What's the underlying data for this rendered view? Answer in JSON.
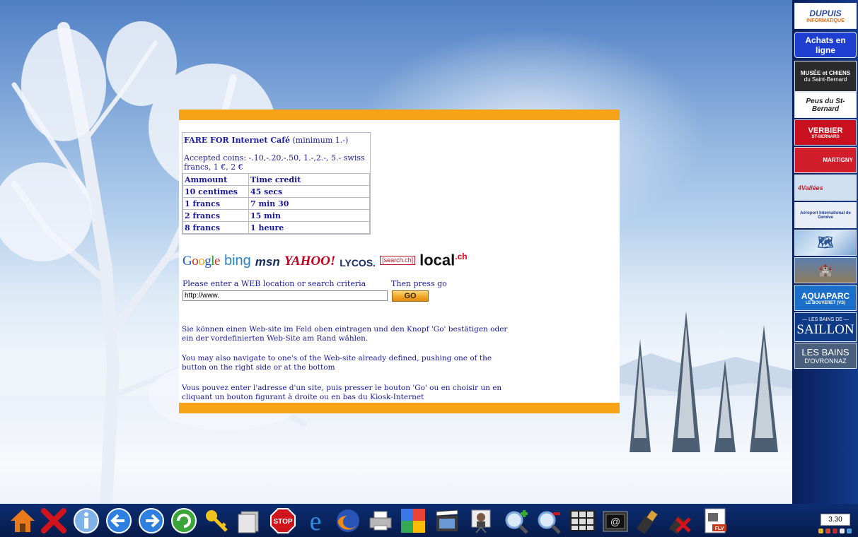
{
  "fare": {
    "title_bold": "FARE FOR  Internet Café",
    "title_rest": " (minimum 1.-)",
    "coins": "Accepted coins:  -.10,-.20,-.50,   1.-,2.-, 5.- swiss francs, 1 €, 2 €",
    "headers": [
      "Ammount",
      "Time credit"
    ],
    "rows": [
      [
        "10 centimes",
        "45 secs"
      ],
      [
        "1 francs",
        "7 min 30"
      ],
      [
        "2 francs",
        "15 min"
      ],
      [
        "8 francs",
        "1 heure"
      ]
    ]
  },
  "engines": {
    "google": "Google",
    "bing": "bing",
    "msn": "msn",
    "yahoo": "YAHOO!",
    "lycos": "LYCOS.",
    "searchch": "[search.ch]",
    "local": "local",
    "local_suffix": ".ch"
  },
  "search": {
    "prompt": "Please enter a WEB location or search criteria",
    "then": "Then press go",
    "url_value": "http://www.",
    "go_label": "GO"
  },
  "messages": {
    "de": "Sie können einen Web-site im Feld oben eintragen und den Knopf 'Go' bestätigen oder ein der vordefinierten Web-Site am Rand wählen.",
    "en": "You may also navigate to one's of the Web-site already defined, pushing one of the button on the right side or at the bottom",
    "fr": " Vous pouvez enter l'adresse d'un site, puis presser le bouton 'Go' ou en choisir un en cliquant un bouton figurant à droite ou en bas du Kiosk-Internet"
  },
  "sidebar": [
    {
      "name": "dupuis-informatique",
      "label": "DUPUIS",
      "sub": "INFORMATIQUE"
    },
    {
      "name": "achats-en-ligne",
      "label": "Achats en ligne",
      "sub": ""
    },
    {
      "name": "musee-chiens",
      "label": "MUSÉE et CHIENS",
      "sub": "du Saint-Bernard"
    },
    {
      "name": "peus-st-bernard",
      "label": "Peus du St-Bernard",
      "sub": ""
    },
    {
      "name": "verbier",
      "label": "VERBIER",
      "sub": "ST-BERNARD"
    },
    {
      "name": "martigny",
      "label": "MARTIGNY",
      "sub": ""
    },
    {
      "name": "4-vallees",
      "label": "4Vallées",
      "sub": ""
    },
    {
      "name": "aeroport-geneve",
      "label": "Aéroport International de Genève",
      "sub": ""
    },
    {
      "name": "map-site",
      "label": "",
      "sub": ""
    },
    {
      "name": "chateau-chillon",
      "label": "",
      "sub": ""
    },
    {
      "name": "aquaparc",
      "label": "AQUAPARC",
      "sub": "LE BOUVERET (VS)"
    },
    {
      "name": "bains-saillon",
      "label": "SAILLON",
      "sub": "— LES BAINS DE —"
    },
    {
      "name": "bains-ovronnaz",
      "label": "LES BAINS",
      "sub": "D'OVRONNAZ"
    }
  ],
  "taskbar": {
    "icons": [
      "home-icon",
      "close-icon",
      "info-icon",
      "back-icon",
      "forward-icon",
      "refresh-icon",
      "key-icon",
      "documents-icon",
      "stop-icon",
      "ie-icon",
      "firefox-icon",
      "printer-icon",
      "google-icon",
      "video-icon",
      "webcam-icon",
      "zoom-in-icon",
      "zoom-out-icon",
      "keyboard-icon",
      "email-icon",
      "usb-icon",
      "usb-remove-icon",
      "flv-icon"
    ],
    "stop_label": "STOP",
    "email_label": "@",
    "flv_label": "FLV",
    "clock": "3.30"
  },
  "colors": {
    "accent_orange": "#f6a316",
    "text_blue": "#1a1aa0"
  }
}
